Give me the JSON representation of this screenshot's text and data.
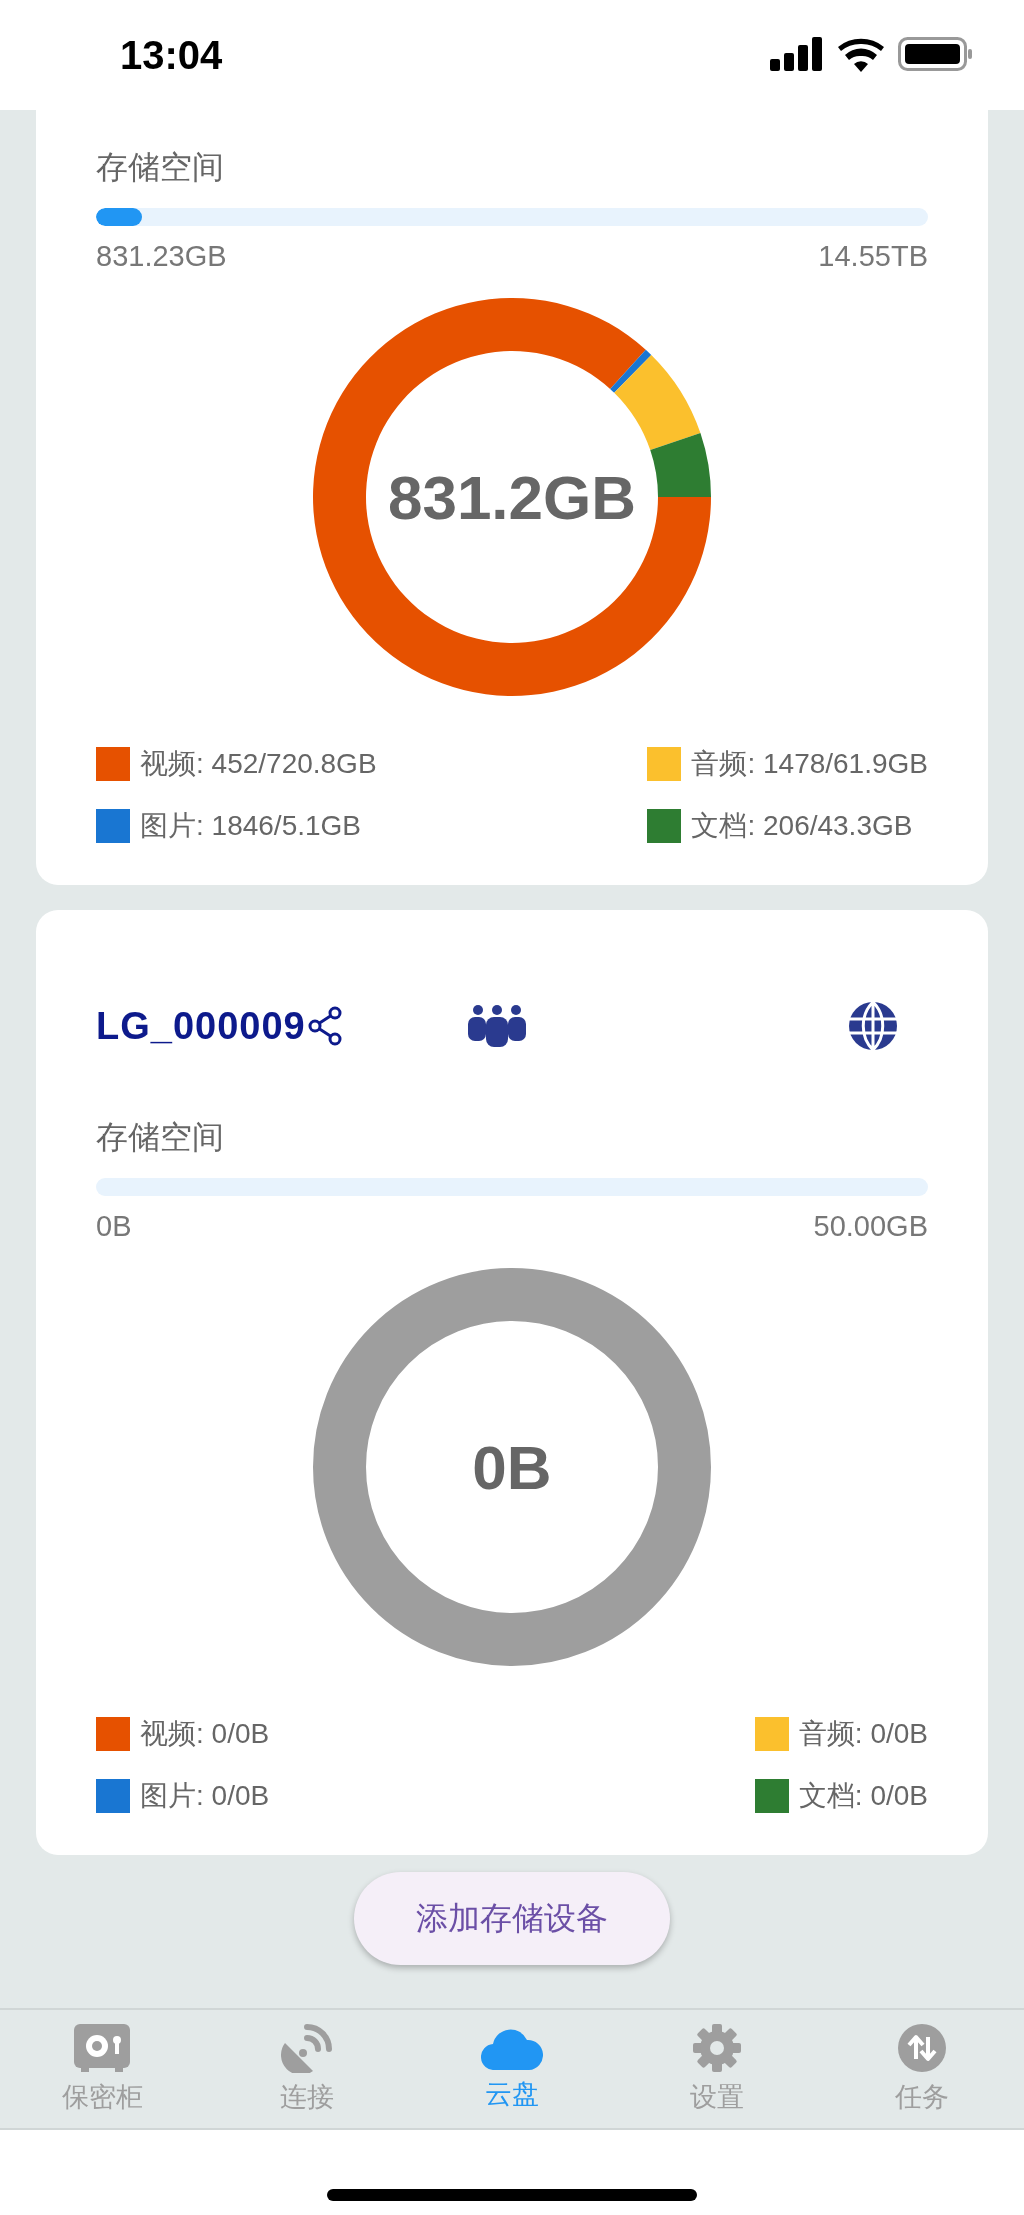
{
  "status_bar": {
    "time": "13:04"
  },
  "storage_cards": [
    {
      "storage_label": "存储空间",
      "usage": {
        "level": 0.055,
        "used": "831.23GB",
        "total": "14.55TB"
      },
      "center_text": "831.2GB",
      "chart_data": {
        "type": "donut",
        "values": [
          86.73,
          0.61,
          7.45,
          5.21
        ],
        "colors": [
          "#e65100",
          "#1976d2",
          "#fbc02d",
          "#2e7d32"
        ]
      },
      "legend": [
        {
          "label": "视频: 452/720.8GB",
          "color": "#e65100"
        },
        {
          "label": "音频: 1478/61.9GB",
          "color": "#fbc02d"
        },
        {
          "label": "图片: 1846/5.1GB",
          "color": "#1976d2"
        },
        {
          "label": "文档: 206/43.3GB",
          "color": "#2e7d32"
        }
      ]
    },
    {
      "header": {
        "device_name": "LG_000009"
      },
      "storage_label": "存储空间",
      "usage": {
        "used": "0B",
        "total": "50.00GB"
      },
      "center_text": "0B",
      "legend": [
        {
          "label": "视频: 0/0B",
          "color": "#e65100"
        },
        {
          "label": "音频: 0/0B",
          "color": "#fbc02d"
        },
        {
          "label": "图片: 0/0B",
          "color": "#1976d2"
        },
        {
          "label": "文档: 0/0B",
          "color": "#2e7d32"
        }
      ]
    }
  ],
  "add_button": "添加存储设备",
  "tab_bar": [
    {
      "kind": "safe",
      "label": "保密柜",
      "selected": false
    },
    {
      "kind": "dish",
      "label": "连接",
      "selected": false
    },
    {
      "kind": "cloud",
      "label": "云盘",
      "selected": true
    },
    {
      "kind": "gear",
      "label": "设置",
      "selected": false
    },
    {
      "kind": "transfer",
      "label": "任务",
      "selected": false
    }
  ]
}
